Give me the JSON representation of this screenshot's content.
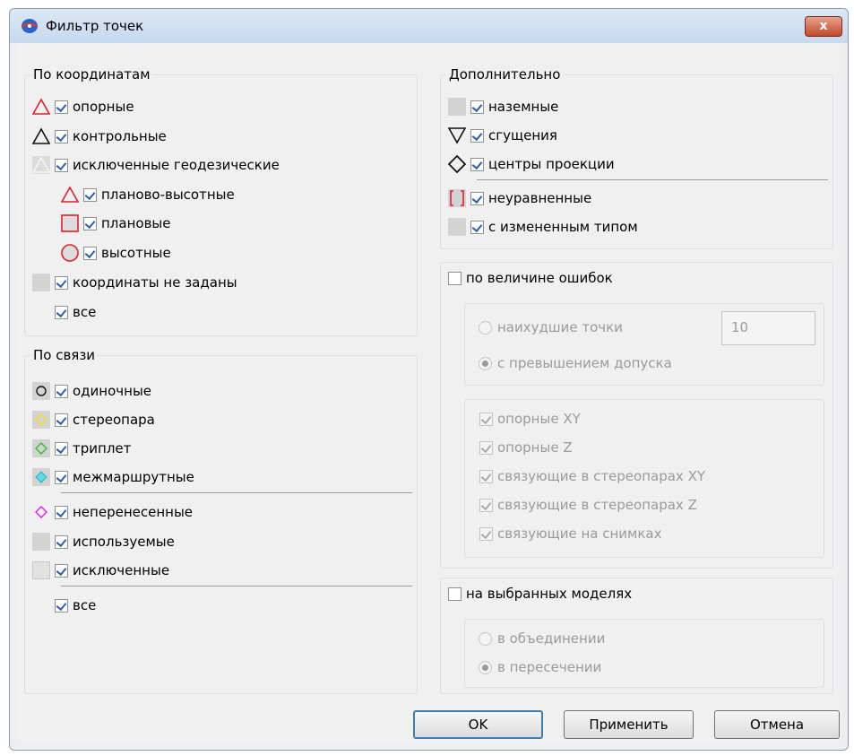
{
  "window": {
    "title": "Фильтр точек",
    "close_label": "x"
  },
  "by_coordinates": {
    "title": "По координатам",
    "items": [
      {
        "label": "опорные",
        "checked": true,
        "icon": "red-triangle-icon"
      },
      {
        "label": "контрольные",
        "checked": true,
        "icon": "black-triangle-icon"
      },
      {
        "label": "исключенные геодезические",
        "checked": true,
        "icon": "gray-triangle-icon"
      },
      {
        "label": "планово-высотные",
        "checked": true,
        "icon": "red-triangle-icon"
      },
      {
        "label": "плановые",
        "checked": true,
        "icon": "red-square-icon"
      },
      {
        "label": "высотные",
        "checked": true,
        "icon": "red-circle-icon"
      },
      {
        "label": "координаты не заданы",
        "checked": true,
        "icon": "gray-square-icon"
      },
      {
        "label": "все",
        "checked": true,
        "icon": ""
      }
    ]
  },
  "by_link": {
    "title": "По связи",
    "items": [
      {
        "label": "одиночные",
        "checked": true,
        "icon": "black-circle-icon"
      },
      {
        "label": "стереопара",
        "checked": true,
        "icon": "yellow-diamond-icon"
      },
      {
        "label": "триплет",
        "checked": true,
        "icon": "green-diamond-icon"
      },
      {
        "label": "межмаршрутные",
        "checked": true,
        "icon": "cyan-diamond-icon"
      },
      {
        "label": "неперенесенные",
        "checked": true,
        "icon": "magenta-diamond-icon"
      },
      {
        "label": "используемые",
        "checked": true,
        "icon": "gray-square-icon"
      },
      {
        "label": "исключенные",
        "checked": true,
        "icon": "light-gray-square-icon"
      },
      {
        "label": "все",
        "checked": true,
        "icon": ""
      }
    ]
  },
  "additional": {
    "title": "Дополнительно",
    "items": [
      {
        "label": "наземные",
        "checked": true,
        "icon": "gray-square-icon"
      },
      {
        "label": "сгущения",
        "checked": true,
        "icon": "inverted-triangle-icon"
      },
      {
        "label": "центры проекции",
        "checked": true,
        "icon": "black-diamond-icon"
      },
      {
        "label": "неуравненные",
        "checked": true,
        "icon": "red-bracket-icon"
      },
      {
        "label": "с измененным типом",
        "checked": true,
        "icon": "gray-square-icon"
      }
    ]
  },
  "errors": {
    "label": "по величине ошибок",
    "checked": false,
    "worst_points_label": "наихудшие точки",
    "worst_points_value": "10",
    "exceed_label": "с превышением допуска",
    "options": [
      {
        "label": "опорные XY",
        "checked": true
      },
      {
        "label": "опорные Z",
        "checked": true
      },
      {
        "label": "связующие в стереопарах XY",
        "checked": true
      },
      {
        "label": "связующие в стереопарах Z",
        "checked": true
      },
      {
        "label": "связующие на снимках",
        "checked": true
      }
    ]
  },
  "models": {
    "label": "на выбранных моделях",
    "checked": false,
    "union_label": "в объединении",
    "intersection_label": "в пересечении"
  },
  "buttons": {
    "ok": "OK",
    "apply": "Применить",
    "cancel": "Отмена"
  }
}
